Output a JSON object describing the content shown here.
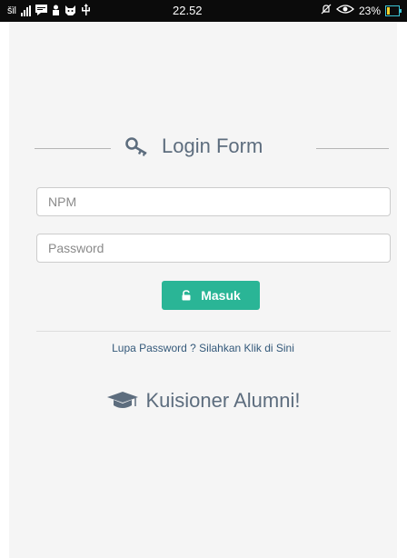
{
  "status_bar": {
    "signal_text": "šìl",
    "time": "22.52",
    "battery_percent": "23%",
    "battery_level": 0.23,
    "icons": [
      "signal-icon",
      "message-icon",
      "person-icon",
      "cat-icon",
      "usb-icon",
      "mute-icon",
      "eye-icon",
      "battery-icon"
    ]
  },
  "login": {
    "heading": "Login Form",
    "heading_icon": "key-icon",
    "npm_placeholder": "NPM",
    "password_placeholder": "Password",
    "submit_label": "Masuk",
    "submit_icon": "unlock-icon",
    "accent_color": "#2ab596"
  },
  "footer": {
    "forgot_text": "Lupa Password ?",
    "forgot_link": "Silahkan Klik di Sini",
    "brand_title": "Kuisioner Alumni!",
    "brand_icon": "graduation-cap-icon"
  }
}
